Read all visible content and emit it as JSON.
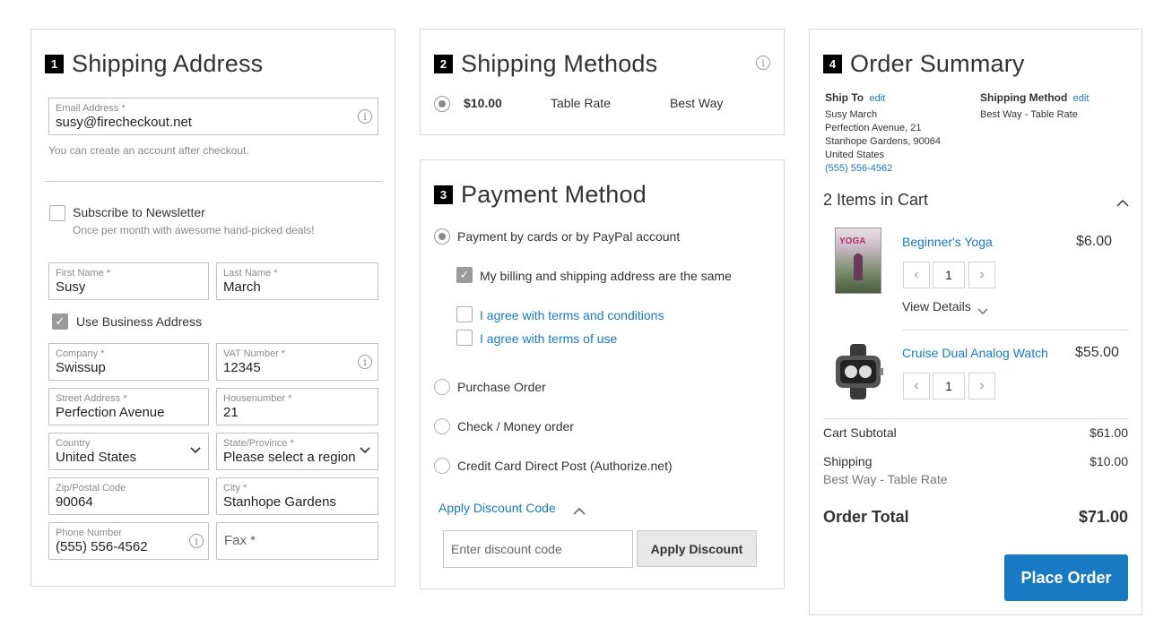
{
  "shipping_address": {
    "step": "1",
    "title": "Shipping Address",
    "email": {
      "label": "Email Address *",
      "value": "susy@firecheckout.net"
    },
    "email_hint": "You can create an account after checkout.",
    "newsletter": {
      "label": "Subscribe to Newsletter",
      "hint": "Once per month with awesome hand-picked deals!"
    },
    "first_name": {
      "label": "First Name *",
      "value": "Susy"
    },
    "last_name": {
      "label": "Last Name *",
      "value": "March"
    },
    "use_business": {
      "label": "Use Business Address"
    },
    "company": {
      "label": "Company *",
      "value": "Swissup"
    },
    "vat": {
      "label": "VAT Number *",
      "value": "12345"
    },
    "street": {
      "label": "Street Address *",
      "value": "Perfection Avenue"
    },
    "housenumber": {
      "label": "Housenumber *",
      "value": "21"
    },
    "country": {
      "label": "Country",
      "value": "United States"
    },
    "region": {
      "label": "State/Province *",
      "value": "Please select a region, "
    },
    "zip": {
      "label": "Zip/Postal Code",
      "value": "90064"
    },
    "city": {
      "label": "City *",
      "value": "Stanhope Gardens"
    },
    "phone": {
      "label": "Phone Number",
      "value": "(555) 556-4562"
    },
    "fax": {
      "placeholder": "Fax *"
    }
  },
  "shipping_methods": {
    "step": "2",
    "title": "Shipping Methods",
    "rate": {
      "price": "$10.00",
      "method": "Table Rate",
      "carrier": "Best Way"
    }
  },
  "payment_method": {
    "step": "3",
    "title": "Payment Method",
    "options": {
      "paypal": "Payment by cards or by PayPal account",
      "purchase_order": "Purchase Order",
      "check": "Check / Money order",
      "authorize": "Credit Card Direct Post (Authorize.net)"
    },
    "billing_same": "My billing and shipping address are the same",
    "agree_terms": "I agree with terms and conditions",
    "agree_use": "I agree with terms of use",
    "discount": {
      "toggle": "Apply Discount Code",
      "placeholder": "Enter discount code",
      "button": "Apply Discount"
    }
  },
  "order_summary": {
    "step": "4",
    "title": "Order Summary",
    "ship_to": {
      "label": "Ship To",
      "edit": "edit",
      "name": "Susy March",
      "street": "Perfection Avenue, 21",
      "city": "Stanhope Gardens, 90064",
      "country": "United States",
      "phone": "(555) 556-4562"
    },
    "shipping_method": {
      "label": "Shipping Method",
      "edit": "edit",
      "value": "Best Way - Table Rate"
    },
    "items_count": "2 Items in Cart",
    "items": [
      {
        "name": "Beginner's Yoga",
        "price": "$6.00",
        "qty": "1",
        "details": "View Details",
        "thumb_text": "YOGA"
      },
      {
        "name": "Cruise Dual Analog Watch",
        "price": "$55.00",
        "qty": "1"
      }
    ],
    "totals": {
      "subtotal_label": "Cart Subtotal",
      "subtotal": "$61.00",
      "shipping_label": "Shipping",
      "shipping": "$10.00",
      "shipping_method": "Best Way - Table Rate",
      "total_label": "Order Total",
      "total": "$71.00"
    },
    "place_order": "Place Order"
  },
  "colors": {
    "link": "#1979c3",
    "primary": "#1979c3"
  }
}
